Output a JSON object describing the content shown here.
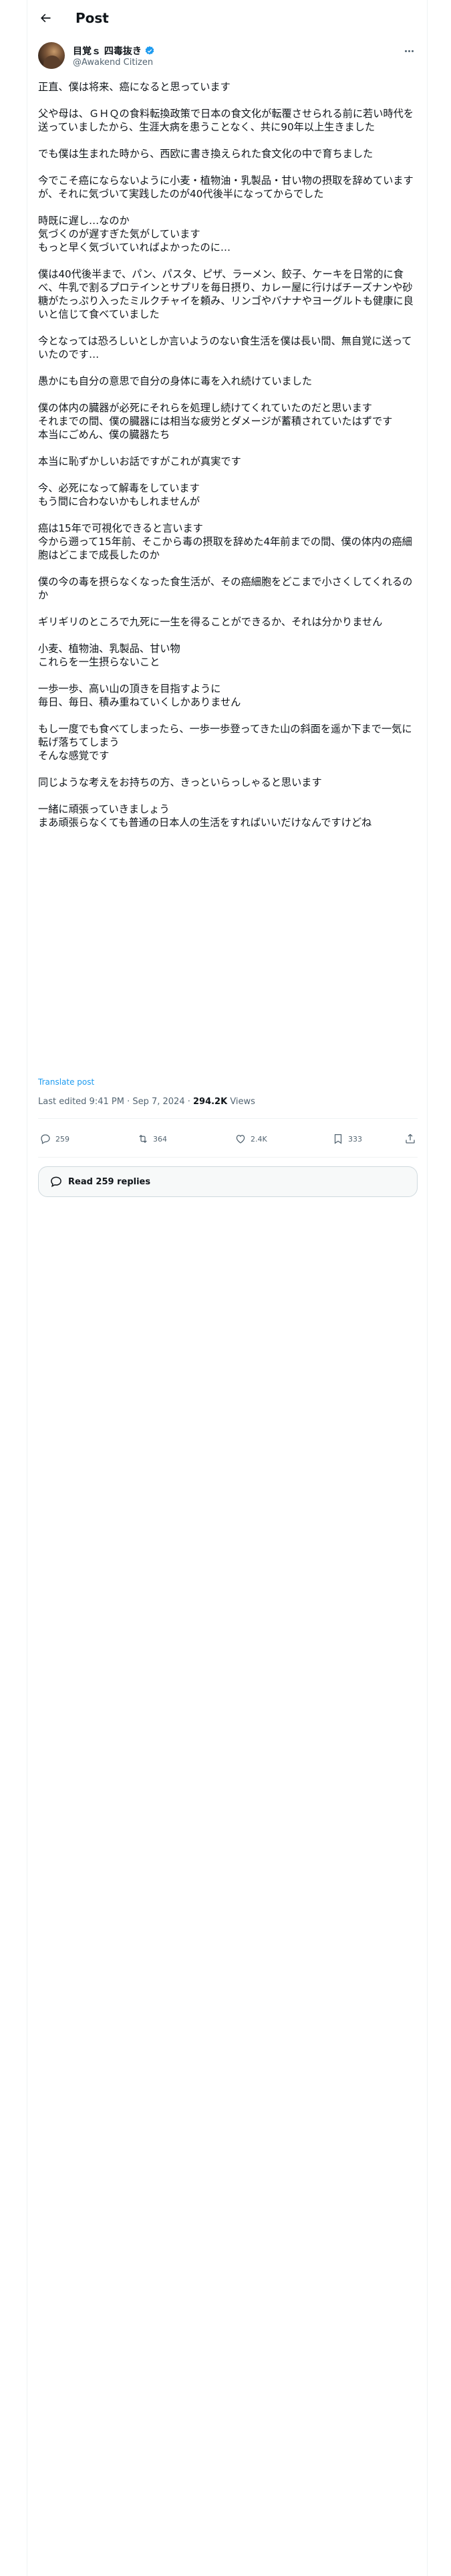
{
  "header": {
    "title": "Post"
  },
  "author": {
    "name": "目覚ｓ 四毒抜き",
    "handle": "@Awakend Citizen"
  },
  "tweet": {
    "text": "正直、僕は将来、癌になると思っています\n\n父や母は、ＧＨＱの食料転換政策で日本の食文化が転覆させられる前に若い時代を送っていましたから、生涯大病を患うことなく、共に90年以上生きました\n\nでも僕は生まれた時から、西欧に書き換えられた食文化の中で育ちました\n\n今でこそ癌にならないように小麦・植物油・乳製品・甘い物の摂取を辞めていますが、それに気づいて実践したのが40代後半になってからでした\n\n時既に遅し…なのか\n気づくのが遅すぎた気がしています\nもっと早く気づいていればよかったのに…\n\n僕は40代後半まで、パン、パスタ、ピザ、ラーメン、餃子、ケーキを日常的に食べ、牛乳で割るプロテインとサプリを毎日摂り、カレー屋に行けばチーズナンや砂糖がたっぷり入ったミルクチャイを頼み、リンゴやバナナやヨーグルトも健康に良いと信じて食べていました\n\n今となっては恐ろしいとしか言いようのない食生活を僕は長い間、無自覚に送っていたのです…\n\n愚かにも自分の意思で自分の身体に毒を入れ続けていました\n\n僕の体内の臓器が必死にそれらを処理し続けてくれていたのだと思います\nそれまでの間、僕の臓器には相当な疲労とダメージが蓄積されていたはずです\n本当にごめん、僕の臓器たち\n\n本当に恥ずかしいお話ですがこれが真実です\n\n今、必死になって解毒をしています\nもう間に合わないかもしれませんが\n\n癌は15年で可視化できると言います\n今から遡って15年前、そこから毒の摂取を辞めた4年前までの間、僕の体内の癌細胞はどこまで成長したのか\n\n僕の今の毒を摂らなくなった食生活が、その癌細胞をどこまで小さくしてくれるのか\n\nギリギリのところで九死に一生を得ることができるか、それは分かりません\n\n小麦、植物油、乳製品、甘い物\nこれらを一生摂らないこと\n\n一歩一歩、高い山の頂きを目指すように\n毎日、毎日、積み重ねていくしかありません\n\nもし一度でも食べてしまったら、一歩一歩登ってきた山の斜面を遥か下まで一気に転げ落ちてしまう\nそんな感覚です\n\n同じような考えをお持ちの方、きっといらっしゃると思います\n\n一緒に頑張っていきましょう\nまあ頑張らなくても普通の日本人の生活をすればいいだけなんですけどね",
    "translate_label": "Translate post"
  },
  "meta": {
    "time": "Last edited 9:41 PM · Sep 7, 2024 · ",
    "views_count": "294.2K",
    "views_label": " Views"
  },
  "actions": {
    "replies": "259",
    "reposts": "364",
    "likes": "2.4K",
    "bookmarks": "333"
  },
  "read_replies": {
    "label": "Read 259 replies"
  },
  "icons": [
    "back-arrow-icon",
    "verified-badge-icon",
    "more-icon",
    "reply-icon",
    "repost-icon",
    "like-icon",
    "bookmark-icon",
    "share-icon",
    "speech-bubble-icon"
  ],
  "colors": {
    "accent": "#1d9bf0",
    "text": "#0f1419",
    "muted": "#536471",
    "border": "#eff3f4"
  }
}
